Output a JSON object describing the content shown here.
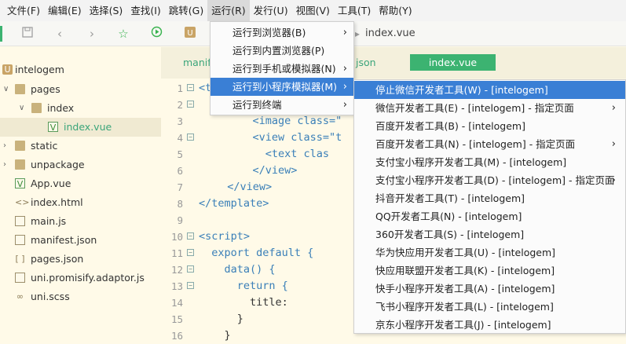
{
  "menubar": [
    {
      "label": "文件(F)"
    },
    {
      "label": "编辑(E)"
    },
    {
      "label": "选择(S)"
    },
    {
      "label": "查找(I)"
    },
    {
      "label": "跳转(G)"
    },
    {
      "label": "运行(R)"
    },
    {
      "label": "发行(U)"
    },
    {
      "label": "视图(V)"
    },
    {
      "label": "工具(T)"
    },
    {
      "label": "帮助(Y)"
    }
  ],
  "toolbar": {
    "icons": [
      "save-icon",
      "back-icon",
      "forward-icon",
      "star-icon",
      "run-icon",
      "project-icon"
    ],
    "active_file": "index.vue",
    "tab_marker": "▸"
  },
  "sidebar": {
    "items": [
      {
        "label": "intelogem",
        "icon": "project-icon"
      },
      {
        "label": "pages",
        "icon": "folder-icon"
      },
      {
        "label": "index",
        "icon": "folder-icon"
      },
      {
        "label": "index.vue",
        "icon": "vue-file-icon"
      },
      {
        "label": "static",
        "icon": "folder-icon"
      },
      {
        "label": "unpackage",
        "icon": "folder-icon"
      },
      {
        "label": "App.vue",
        "icon": "vue-file-icon"
      },
      {
        "label": "index.html",
        "icon": "html-file-icon"
      },
      {
        "label": "main.js",
        "icon": "js-file-icon"
      },
      {
        "label": "manifest.json",
        "icon": "json-file-icon"
      },
      {
        "label": "pages.json",
        "icon": "json-file-icon"
      },
      {
        "label": "uni.promisify.adaptor.js",
        "icon": "js-file-icon"
      },
      {
        "label": "uni.scss",
        "icon": "scss-file-icon"
      }
    ]
  },
  "editor": {
    "tabs": [
      "manif",
      "json",
      "index.vue"
    ],
    "lines": [
      {
        "num": "1",
        "text": "<t"
      },
      {
        "num": "2",
        "text": ""
      },
      {
        "num": "3",
        "text": "    <image class=\""
      },
      {
        "num": "4",
        "text": "    <view class=\"t"
      },
      {
        "num": "5",
        "text": "      <text clas"
      },
      {
        "num": "6",
        "text": "    </view>"
      },
      {
        "num": "7",
        "text": "  </view>"
      },
      {
        "num": "8",
        "text": "</template>"
      },
      {
        "num": "9",
        "text": ""
      },
      {
        "num": "10",
        "text": "<script>"
      },
      {
        "num": "11",
        "text": "  export default {"
      },
      {
        "num": "12",
        "text": "    data() {"
      },
      {
        "num": "13",
        "text": "      return {"
      },
      {
        "num": "14",
        "text": "        title:"
      },
      {
        "num": "15",
        "text": "      }"
      },
      {
        "num": "16",
        "text": "    }"
      }
    ]
  },
  "run_menu": {
    "items": [
      {
        "label": "运行到浏览器(B)",
        "submenu": true
      },
      {
        "label": "运行到内置浏览器(P)",
        "submenu": false
      },
      {
        "label": "运行到手机或模拟器(N)",
        "submenu": true
      },
      {
        "label": "运行到小程序模拟器(M)",
        "submenu": true
      },
      {
        "label": "运行到终端",
        "submenu": true
      }
    ]
  },
  "miniprogram_menu": {
    "items": [
      {
        "label": "停止微信开发者工具(W) - [intelogem]",
        "submenu": false
      },
      {
        "label": "微信开发者工具(E) - [intelogem] - 指定页面",
        "submenu": true
      },
      {
        "label": "百度开发者工具(B) - [intelogem]",
        "submenu": false
      },
      {
        "label": "百度开发者工具(N) - [intelogem] - 指定页面",
        "submenu": true
      },
      {
        "label": "支付宝小程序开发者工具(M) - [intelogem]",
        "submenu": false
      },
      {
        "label": "支付宝小程序开发者工具(D) - [intelogem] - 指定页面",
        "submenu": true
      },
      {
        "label": "抖音开发者工具(T) - [intelogem]",
        "submenu": false
      },
      {
        "label": "QQ开发者工具(N) - [intelogem]",
        "submenu": false
      },
      {
        "label": "360开发者工具(S) - [intelogem]",
        "submenu": false
      },
      {
        "label": "华为快应用开发者工具(U) - [intelogem]",
        "submenu": false
      },
      {
        "label": "快应用联盟开发者工具(K) - [intelogem]",
        "submenu": false
      },
      {
        "label": "快手小程序开发者工具(A) - [intelogem]",
        "submenu": false
      },
      {
        "label": "飞书小程序开发者工具(L) - [intelogem]",
        "submenu": false
      },
      {
        "label": "京东小程序开发者工具(J) - [intelogem]",
        "submenu": false
      }
    ]
  },
  "colors": {
    "accent": "#3a7fd5",
    "editor_bg": "#fffae8",
    "active_tab": "#3cb371"
  }
}
